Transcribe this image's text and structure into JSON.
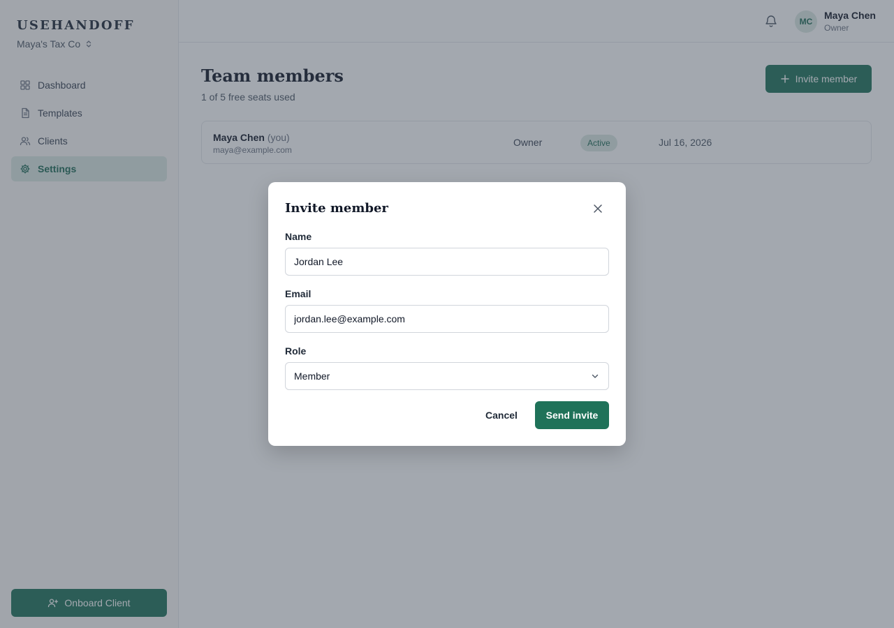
{
  "sidebar": {
    "brand": "USEHANDOFF",
    "org": "Maya's Tax Co",
    "items": [
      {
        "label": "Dashboard",
        "icon": "grid-icon"
      },
      {
        "label": "Templates",
        "icon": "document-icon"
      },
      {
        "label": "Clients",
        "icon": "users-icon"
      },
      {
        "label": "Settings",
        "icon": "gear-icon",
        "active": true
      }
    ],
    "onboard_label": "Onboard Client"
  },
  "topbar": {
    "avatar_initials": "MC",
    "user_name": "Maya Chen",
    "user_role": "Owner"
  },
  "main": {
    "title": "Team members",
    "subtitle": "1 of 5 free seats used",
    "invite_label": "Invite member",
    "members": [
      {
        "name": "Maya Chen",
        "you": "(you)",
        "email": "maya@example.com",
        "role": "Owner",
        "status": "Active",
        "date": "Jul 16, 2026"
      }
    ]
  },
  "modal": {
    "title": "Invite member",
    "name_label": "Name",
    "name_value": "Jordan Lee",
    "email_label": "Email",
    "email_value": "jordan.lee@example.com",
    "role_label": "Role",
    "role_value": "Member",
    "cancel_label": "Cancel",
    "send_label": "Send invite"
  },
  "colors": {
    "accent": "#1f7259",
    "accent_soft": "#dce9e3",
    "overlay": "#3c4655"
  }
}
